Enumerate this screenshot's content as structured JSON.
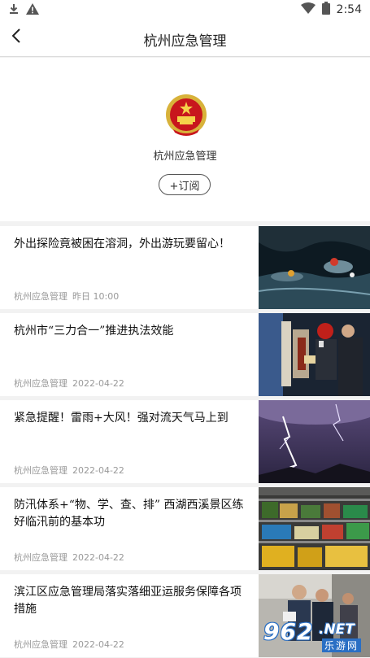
{
  "status_bar": {
    "time": "2:54",
    "icons": [
      "download-icon",
      "warning-icon",
      "wifi-icon",
      "battery-icon"
    ]
  },
  "nav": {
    "title": "杭州应急管理",
    "back_icon": "chevron-left-icon"
  },
  "header": {
    "emblem_icon": "national-emblem-icon",
    "org_name": "杭州应急管理",
    "subscribe_label": "+订阅"
  },
  "articles": [
    {
      "title": "外出探险竟被困在溶洞，外出游玩要留心！",
      "source": "杭州应急管理",
      "date": "昨日 10:00",
      "thumb": "cave-rescue-photo"
    },
    {
      "title": "杭州市“三力合一”推进执法效能",
      "source": "杭州应急管理",
      "date": "2022-04-22",
      "thumb": "inspection-photo"
    },
    {
      "title": "紧急提醒！雷雨+大风！强对流天气马上到",
      "source": "杭州应急管理",
      "date": "2022-04-22",
      "thumb": "lightning-photo"
    },
    {
      "title": "防汛体系+“物、学、查、排” 西湖西溪景区练好临汛前的基本功",
      "source": "杭州应急管理",
      "date": "2022-04-22",
      "thumb": "warehouse-photo"
    },
    {
      "title": "滨江区应急管理局落实落细亚运服务保障各项措施",
      "source": "杭州应急管理",
      "date": "2022-04-22",
      "thumb": "meeting-photo"
    }
  ],
  "watermark": {
    "number": "962",
    "suffix": ".NET",
    "site_name": "乐游网"
  }
}
